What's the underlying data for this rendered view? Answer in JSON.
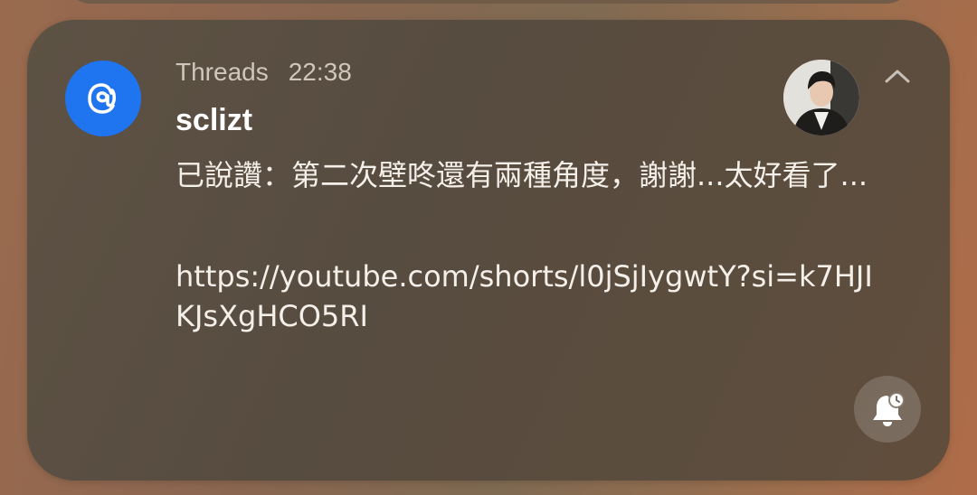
{
  "notification": {
    "app_name": "Threads",
    "time": "22:38",
    "sender": "sclizt",
    "message": "已說讚：第二次壁咚還有兩種角度，謝謝...太好看了...",
    "link": "https://youtube.com/shorts/l0jSjIygwtY?si=k7HJIKJsXgHCO5RI",
    "app_icon": "threads-logo-icon",
    "avatar": "user-avatar",
    "collapse_icon": "chevron-up-icon",
    "snooze_icon": "bell-snooze-icon"
  },
  "colors": {
    "app_icon_bg": "#1f74f0",
    "card_bg": "#574c40",
    "text_primary": "#ffffff",
    "text_secondary": "#cfc7bc"
  }
}
